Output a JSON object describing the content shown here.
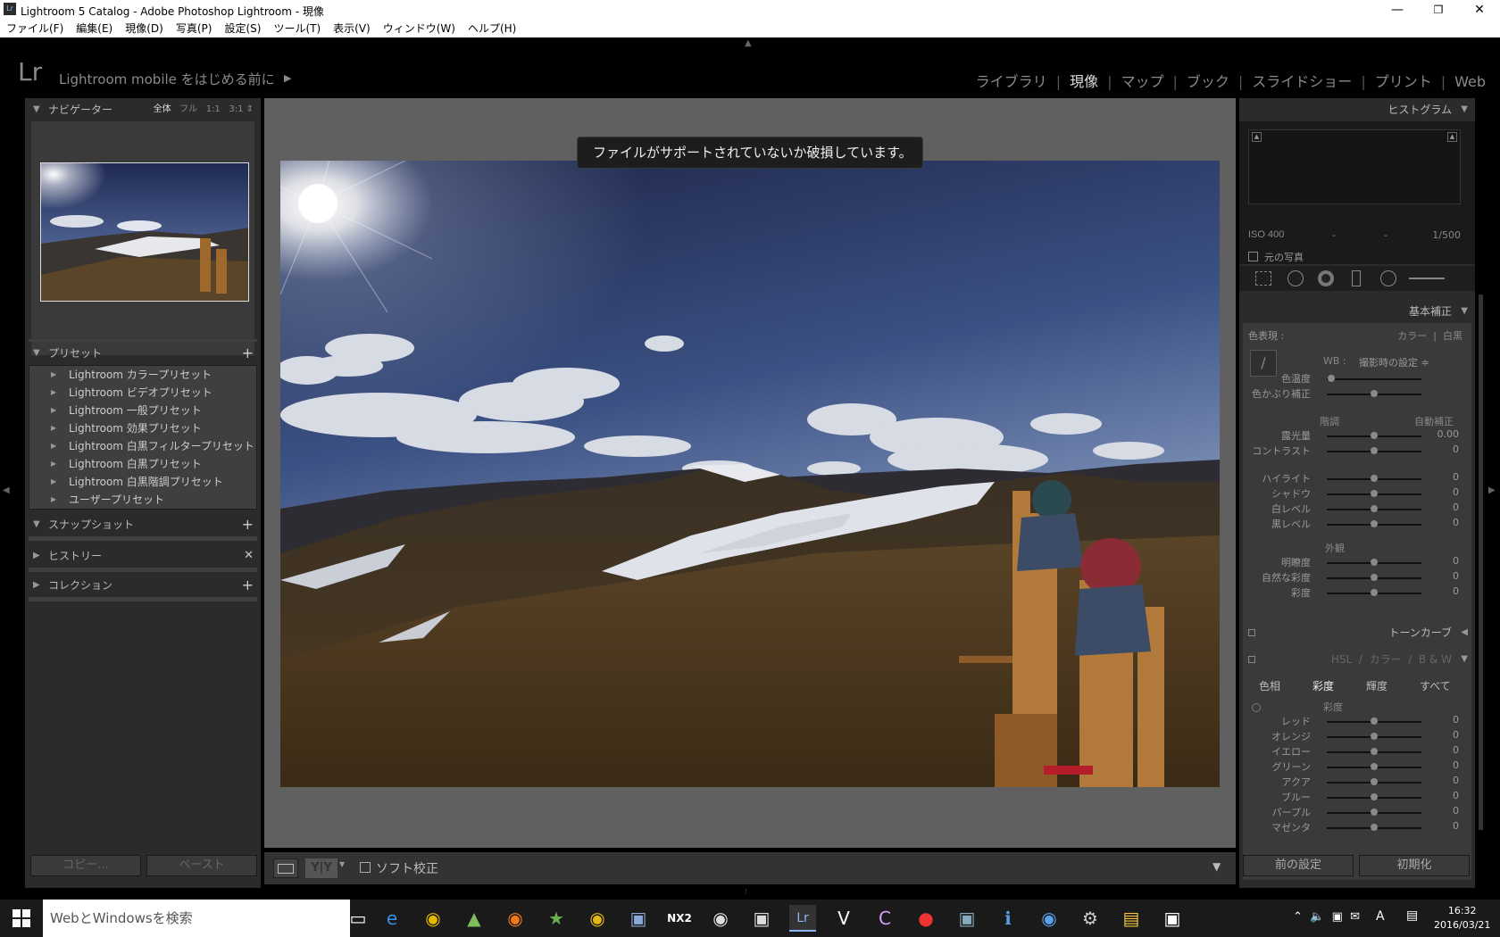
{
  "window": {
    "title": "Lightroom 5 Catalog - Adobe Photoshop Lightroom - 現像",
    "app_icon": "Lr"
  },
  "menu": [
    "ファイル(F)",
    "編集(E)",
    "現像(D)",
    "写真(P)",
    "設定(S)",
    "ツール(T)",
    "表示(V)",
    "ウィンドウ(W)",
    "ヘルプ(H)"
  ],
  "identity": {
    "logo": "Lr",
    "text": "Lightroom mobile をはじめる前に"
  },
  "modules": [
    {
      "label": "ライブラリ"
    },
    {
      "label": "現像",
      "active": true
    },
    {
      "label": "マップ"
    },
    {
      "label": "ブック"
    },
    {
      "label": "スライドショー"
    },
    {
      "label": "プリント"
    },
    {
      "label": "Web"
    }
  ],
  "left": {
    "navigator": {
      "title": "ナビゲーター",
      "zooms": [
        "全体",
        "フル",
        "1:1",
        "3:1"
      ]
    },
    "presets": {
      "title": "プリセット",
      "items": [
        "Lightroom カラープリセット",
        "Lightroom ビデオプリセット",
        "Lightroom 一般プリセット",
        "Lightroom 効果プリセット",
        "Lightroom 白黒フィルタープリセット",
        "Lightroom 白黒プリセット",
        "Lightroom 白黒階調プリセット",
        "ユーザープリセット"
      ]
    },
    "snapshots": {
      "title": "スナップショット"
    },
    "history": {
      "title": "ヒストリー"
    },
    "collections": {
      "title": "コレクション"
    },
    "copy": "コピー...",
    "paste": "ペースト"
  },
  "center": {
    "message": "ファイルがサポートされていないか破損しています。",
    "soft_proof": "ソフト校正",
    "yy": "Y|Y"
  },
  "right": {
    "histogram": {
      "title": "ヒストグラム",
      "iso": "ISO 400",
      "dash1": "-",
      "dash2": "-",
      "shutter": "1/500",
      "original": "元の写真"
    },
    "basic": {
      "title": "基本補正",
      "treatment": "色表現 :",
      "color": "カラー",
      "bw": "白黒",
      "wb_label": "WB :",
      "wb_value": "撮影時の設定 ≑",
      "temp": "色温度",
      "tint": "色かぶり補正",
      "tone": "階調",
      "auto": "自動補正",
      "exposure": "露光量",
      "exposure_v": "0.00",
      "contrast": "コントラスト",
      "contrast_v": "0",
      "highlights": "ハイライト",
      "shadows": "シャドウ",
      "whites": "白レベル",
      "blacks": "黒レベル",
      "presence": "外観",
      "clarity": "明瞭度",
      "vibrance": "自然な彩度",
      "saturation": "彩度",
      "zero": "0"
    },
    "tonecurve": {
      "title": "トーンカーブ"
    },
    "hsl": {
      "hsl": "HSL",
      "color": "カラー",
      "bw": "B & W",
      "slash": "/",
      "tabs": [
        "色相",
        "彩度",
        "輝度",
        "すべて"
      ],
      "section": "彩度",
      "rows": [
        "レッド",
        "オレンジ",
        "イエロー",
        "グリーン",
        "アクア",
        "ブルー",
        "パープル",
        "マゼンタ"
      ]
    },
    "prev": "前の設定",
    "reset": "初期化"
  },
  "taskbar": {
    "search": "WebとWindowsを検索",
    "time": "16:32",
    "date": "2016/03/21",
    "ime": "A",
    "nx2": "NX2"
  }
}
